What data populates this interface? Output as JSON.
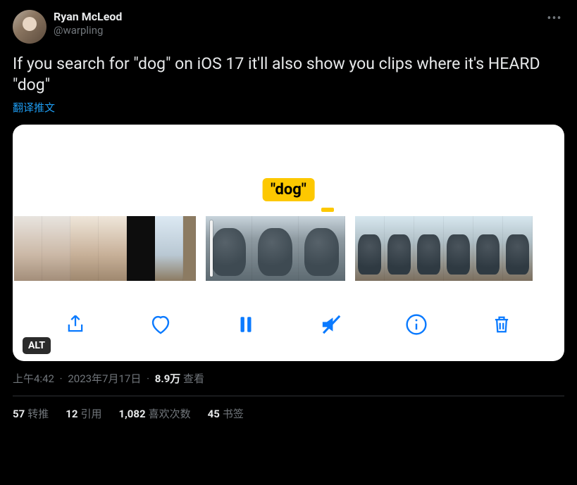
{
  "author": {
    "display_name": "Ryan McLeod",
    "handle": "@warpling"
  },
  "body_text": "If you search for \"dog\" on iOS 17 it'll also show you clips where it's HEARD \"dog\"",
  "translate_label": "翻译推文",
  "media": {
    "caption_chip": "\"dog\"",
    "alt_label": "ALT",
    "toolbar": {
      "share": "share",
      "like": "like",
      "pause": "pause",
      "mute": "mute",
      "info": "info",
      "trash": "trash"
    }
  },
  "meta": {
    "time": "上午4:42",
    "date": "2023年7月17日",
    "separator": "·",
    "views_count": "8.9万",
    "views_label": "查看"
  },
  "stats": {
    "retweets": {
      "count": "57",
      "label": "转推"
    },
    "quotes": {
      "count": "12",
      "label": "引用"
    },
    "likes": {
      "count": "1,082",
      "label": "喜欢次数"
    },
    "bookmarks": {
      "count": "45",
      "label": "书签"
    }
  }
}
